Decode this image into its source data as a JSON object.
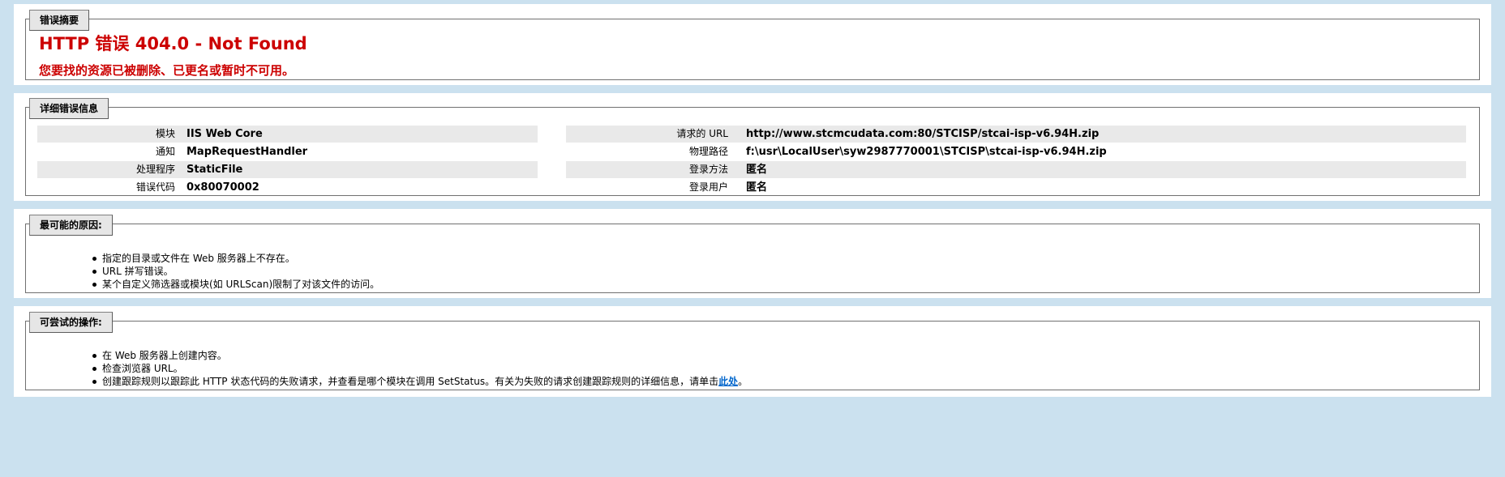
{
  "summary": {
    "legend": "错误摘要",
    "title": "HTTP 错误 404.0 - Not Found",
    "subtitle": "您要找的资源已被删除、已更名或暂时不可用。"
  },
  "details": {
    "legend": "详细错误信息",
    "left": [
      {
        "key": "模块",
        "value": "IIS Web Core"
      },
      {
        "key": "通知",
        "value": "MapRequestHandler"
      },
      {
        "key": "处理程序",
        "value": "StaticFile"
      },
      {
        "key": "错误代码",
        "value": "0x80070002"
      }
    ],
    "right": [
      {
        "key": "请求的 URL",
        "value": "http://www.stcmcudata.com:80/STCISP/stcai-isp-v6.94H.zip"
      },
      {
        "key": "物理路径",
        "value": "f:\\usr\\LocalUser\\syw2987770001\\STCISP\\stcai-isp-v6.94H.zip"
      },
      {
        "key": "登录方法",
        "value": "匿名"
      },
      {
        "key": "登录用户",
        "value": "匿名"
      }
    ]
  },
  "causes": {
    "legend": "最可能的原因:",
    "items": [
      "指定的目录或文件在 Web 服务器上不存在。",
      "URL 拼写错误。",
      "某个自定义筛选器或模块(如 URLScan)限制了对该文件的访问。"
    ]
  },
  "actions": {
    "legend": "可尝试的操作:",
    "items": [
      "在 Web 服务器上创建内容。",
      "检查浏览器 URL。"
    ],
    "last_item_text": "创建跟踪规则以跟踪此 HTTP 状态代码的失败请求，并查看是哪个模块在调用 SetStatus。有关为失败的请求创建跟踪规则的详细信息，请单击",
    "link_label": "此处",
    "last_item_suffix": "。"
  },
  "colors": {
    "page_background": "#CBE1EF",
    "error_red": "#CC0000",
    "link": "#0066CC",
    "row_shade": "#E9E9E9"
  }
}
